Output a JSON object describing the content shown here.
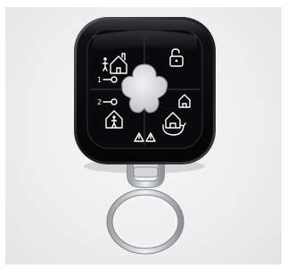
{
  "photo": {
    "subject": "keyfob-remote",
    "colors": {
      "backdrop": "#ececec",
      "body": "#0c0c0e",
      "bezel": "#2a2a2e",
      "center_button": "#d9d9dc",
      "icon_stroke": "#ffffff",
      "metal": "#c9ccd1"
    },
    "buttons": [
      {
        "name": "arm-home",
        "icon": "home-person-icon"
      },
      {
        "name": "unlock",
        "icon": "unlock-icon"
      },
      {
        "name": "key-one",
        "icon": "key-1-icon"
      },
      {
        "name": "key-two",
        "icon": "key-2-icon"
      },
      {
        "name": "partial-arm",
        "icon": "house-small-icon"
      },
      {
        "name": "home-stay",
        "icon": "home-person-icon"
      },
      {
        "name": "panic-left",
        "icon": "warning-icon"
      },
      {
        "name": "panic-right",
        "icon": "warning-icon"
      },
      {
        "name": "disarm",
        "icon": "house-rotate-icon"
      },
      {
        "name": "center",
        "icon": "flower-button"
      }
    ],
    "labels": {
      "key1": "1",
      "key2": "2"
    }
  }
}
